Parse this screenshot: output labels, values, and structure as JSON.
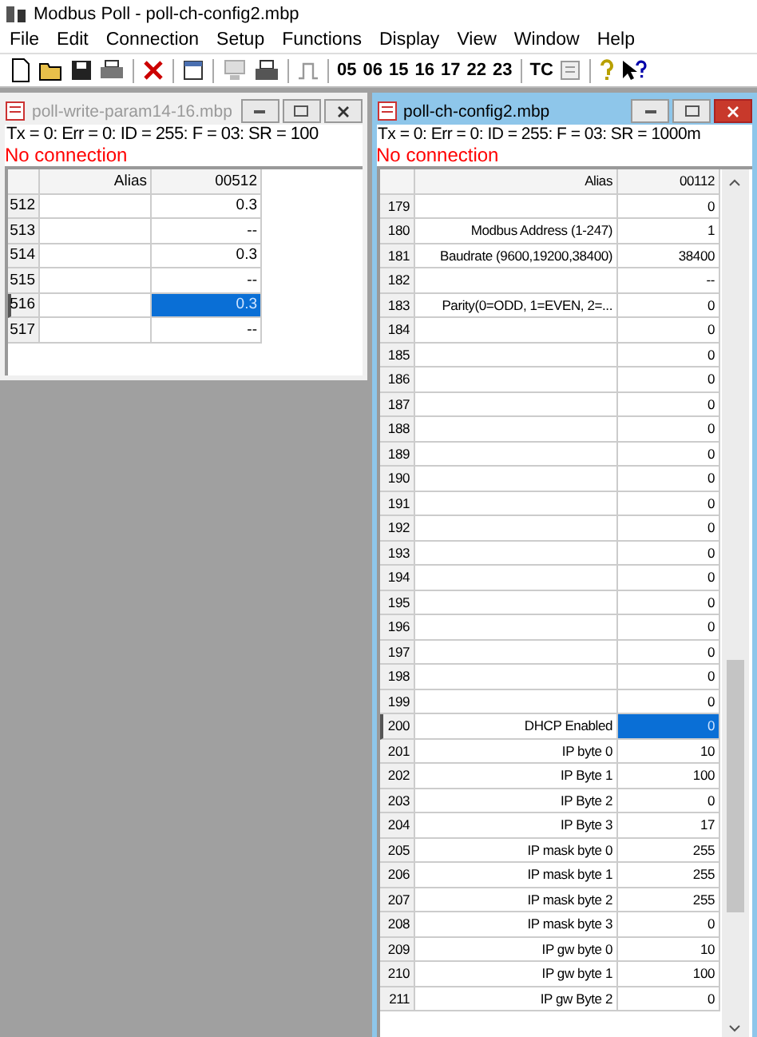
{
  "app": {
    "title": "Modbus Poll - poll-ch-config2.mbp"
  },
  "menu": [
    "File",
    "Edit",
    "Connection",
    "Setup",
    "Functions",
    "Display",
    "View",
    "Window",
    "Help"
  ],
  "toolbar": {
    "function_codes": [
      "05",
      "06",
      "15",
      "16",
      "17",
      "22",
      "23"
    ],
    "tc": "TC"
  },
  "windows": [
    {
      "title": "poll-write-param14-16.mbp",
      "active": false,
      "status": "Tx = 0: Err = 0: ID = 255: F = 03: SR = 100",
      "connection": "No connection",
      "columns": [
        "Alias",
        "00512"
      ],
      "rows": [
        {
          "num": "512",
          "value": "0.3",
          "selected": false
        },
        {
          "num": "513",
          "value": "--",
          "selected": false
        },
        {
          "num": "514",
          "value": "0.3",
          "selected": false
        },
        {
          "num": "515",
          "value": "--",
          "selected": false
        },
        {
          "num": "516",
          "value": "0.3",
          "selected": true
        },
        {
          "num": "517",
          "value": "--",
          "selected": false
        }
      ]
    },
    {
      "title": "poll-ch-config2.mbp",
      "active": true,
      "status": "Tx = 0: Err = 0: ID = 255: F = 03: SR = 1000m",
      "connection": "No connection",
      "columns": [
        "Alias",
        "00112"
      ],
      "rows": [
        {
          "num": "179",
          "value": "0",
          "selected": false
        },
        {
          "num": "180",
          "alias": "Modbus Address (1-247)",
          "value": "1",
          "selected": false
        },
        {
          "num": "181",
          "alias": "Baudrate (9600,19200,38400)",
          "value": "38400",
          "selected": false
        },
        {
          "num": "182",
          "value": "--",
          "selected": false
        },
        {
          "num": "183",
          "alias": "Parity(0=ODD, 1=EVEN, 2=...",
          "value": "0",
          "selected": false
        },
        {
          "num": "184",
          "value": "0",
          "selected": false
        },
        {
          "num": "185",
          "value": "0",
          "selected": false
        },
        {
          "num": "186",
          "value": "0",
          "selected": false
        },
        {
          "num": "187",
          "value": "0",
          "selected": false
        },
        {
          "num": "188",
          "value": "0",
          "selected": false
        },
        {
          "num": "189",
          "value": "0",
          "selected": false
        },
        {
          "num": "190",
          "value": "0",
          "selected": false
        },
        {
          "num": "191",
          "value": "0",
          "selected": false
        },
        {
          "num": "192",
          "value": "0",
          "selected": false
        },
        {
          "num": "193",
          "value": "0",
          "selected": false
        },
        {
          "num": "194",
          "value": "0",
          "selected": false
        },
        {
          "num": "195",
          "value": "0",
          "selected": false
        },
        {
          "num": "196",
          "value": "0",
          "selected": false
        },
        {
          "num": "197",
          "value": "0",
          "selected": false
        },
        {
          "num": "198",
          "value": "0",
          "selected": false
        },
        {
          "num": "199",
          "value": "0",
          "selected": false
        },
        {
          "num": "200",
          "alias": "DHCP Enabled",
          "value": "0",
          "selected": true
        },
        {
          "num": "201",
          "alias": "IP byte 0",
          "value": "10",
          "selected": false
        },
        {
          "num": "202",
          "alias": "IP Byte 1",
          "value": "100",
          "selected": false
        },
        {
          "num": "203",
          "alias": "IP Byte 2",
          "value": "0",
          "selected": false
        },
        {
          "num": "204",
          "alias": "IP Byte 3",
          "value": "17",
          "selected": false
        },
        {
          "num": "205",
          "alias": "IP mask byte 0",
          "value": "255",
          "selected": false
        },
        {
          "num": "206",
          "alias": "IP mask byte 1",
          "value": "255",
          "selected": false
        },
        {
          "num": "207",
          "alias": "IP mask byte 2",
          "value": "255",
          "selected": false
        },
        {
          "num": "208",
          "alias": "IP mask byte 3",
          "value": "0",
          "selected": false
        },
        {
          "num": "209",
          "alias": "IP gw byte 0",
          "value": "10",
          "selected": false
        },
        {
          "num": "210",
          "alias": "IP gw byte 1",
          "value": "100",
          "selected": false
        },
        {
          "num": "211",
          "alias": "IP gw Byte 2",
          "value": "0",
          "selected": false
        }
      ]
    }
  ]
}
